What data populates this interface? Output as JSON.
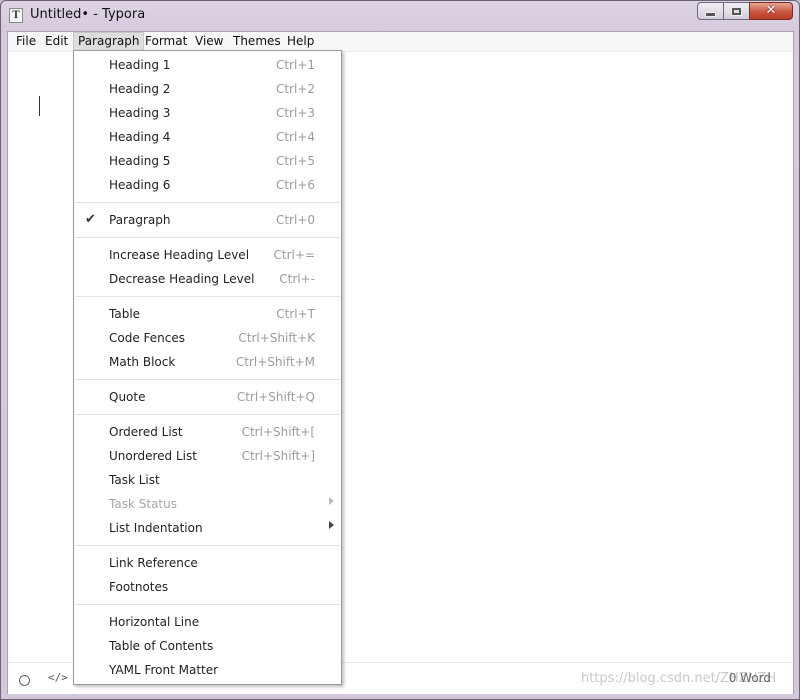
{
  "window": {
    "title": "Untitled• - Typora",
    "app_icon_letter": "T",
    "close_glyph": "✕"
  },
  "menubar": [
    "File",
    "Edit",
    "Paragraph",
    "Format",
    "View",
    "Themes",
    "Help"
  ],
  "active_menu": "Paragraph",
  "dropdown": {
    "items": [
      {
        "label": "Heading 1",
        "shortcut": "Ctrl+1"
      },
      {
        "label": "Heading 2",
        "shortcut": "Ctrl+2"
      },
      {
        "label": "Heading 3",
        "shortcut": "Ctrl+3"
      },
      {
        "label": "Heading 4",
        "shortcut": "Ctrl+4"
      },
      {
        "label": "Heading 5",
        "shortcut": "Ctrl+5"
      },
      {
        "label": "Heading 6",
        "shortcut": "Ctrl+6"
      },
      {
        "label": "Paragraph",
        "shortcut": "Ctrl+0",
        "checked": true,
        "check_glyph": "✔"
      },
      {
        "label": "Increase Heading Level",
        "shortcut": "Ctrl+="
      },
      {
        "label": "Decrease Heading Level",
        "shortcut": "Ctrl+-"
      },
      {
        "label": "Table",
        "shortcut": "Ctrl+T"
      },
      {
        "label": "Code Fences",
        "shortcut": "Ctrl+Shift+K"
      },
      {
        "label": "Math Block",
        "shortcut": "Ctrl+Shift+M"
      },
      {
        "label": "Quote",
        "shortcut": "Ctrl+Shift+Q"
      },
      {
        "label": "Ordered List",
        "shortcut": "Ctrl+Shift+["
      },
      {
        "label": "Unordered List",
        "shortcut": "Ctrl+Shift+]"
      },
      {
        "label": "Task List",
        "shortcut": ""
      },
      {
        "label": "Task Status",
        "shortcut": "",
        "submenu": true,
        "disabled": true
      },
      {
        "label": "List Indentation",
        "shortcut": "",
        "submenu": true
      },
      {
        "label": "Link Reference",
        "shortcut": ""
      },
      {
        "label": "Footnotes",
        "shortcut": ""
      },
      {
        "label": "Horizontal Line",
        "shortcut": ""
      },
      {
        "label": "Table of Contents",
        "shortcut": ""
      },
      {
        "label": "YAML Front Matter",
        "shortcut": ""
      }
    ]
  },
  "statusbar": {
    "code_icon_glyph": "</>",
    "word_count": "0 Word",
    "watermark": "https://blog.csdn.net/ZHZHZH"
  }
}
